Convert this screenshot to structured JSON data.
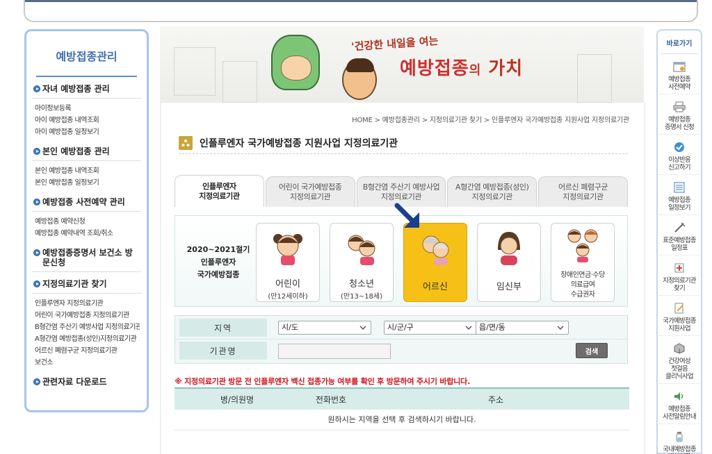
{
  "sidebar": {
    "title": "예방접종관리",
    "sections": [
      {
        "head": "자녀 예방접종 관리",
        "links": [
          "아이정보등록",
          "아이 예방접종 내역조회",
          "아이 예방접종 일정보기"
        ]
      },
      {
        "head": "본인 예방접종 관리",
        "links": [
          "본인 예방접종 내역조회",
          "본인 예방접종 일정보기"
        ]
      },
      {
        "head": "예방접종 사전예약 관리",
        "links": [
          "예방접종 예약신청",
          "예방접종 예약내역 조회/취소"
        ]
      },
      {
        "head": "예방접종증명서 보건소 방문신청",
        "links": []
      },
      {
        "head": "지정의료기관 찾기",
        "links": [
          "인플루엔자 지정의료기관",
          "어린이 국가예방접종 지정의료기관",
          "B형간염 주산기 예방사업 지정의료기관",
          "A형간염 예방접종(성인)지정의료기관",
          "어르신 폐렴구균 지정의료기관",
          "보건소"
        ]
      },
      {
        "head": "관련자료 다운로드",
        "links": []
      }
    ]
  },
  "banner": {
    "slogan": "'건강한 내일을 여는",
    "main_a": "예방접종",
    "main_b": "의",
    "main_c": "가치"
  },
  "breadcrumb": "HOME > 예방접종관리 > 지정의료기관 찾기 > 인플루엔자 국가예방접종 지원사업 지정의료기관",
  "page_title": "인플루엔자 국가예방접종 지원사업 지정의료기관",
  "tabs": [
    {
      "l1": "인플루엔자",
      "l2": "지정의료기관"
    },
    {
      "l1": "어린이 국가예방접종",
      "l2": "지정의료기관"
    },
    {
      "l1": "B형간염 주산기 예방사업",
      "l2": "지정의료기관"
    },
    {
      "l1": "A형간염 예방접종(성인)",
      "l2": "지정의료기관"
    },
    {
      "l1": "어르신 폐렴구균",
      "l2": "지정의료기관"
    }
  ],
  "category_label": {
    "l1": "2020~2021절기",
    "l2": "인플루엔자",
    "l3": "국가예방접종"
  },
  "categories": [
    {
      "name": "어린이",
      "sub": "(만12세이하)"
    },
    {
      "name": "청소년",
      "sub": "(만13~18세)"
    },
    {
      "name": "어르신",
      "sub": ""
    },
    {
      "name": "임신부",
      "sub": ""
    },
    {
      "l1": "장애인연금·수당",
      "l2": "의료급여",
      "l3": "수급권자"
    }
  ],
  "search": {
    "region_label": "지역",
    "sido": "시/도",
    "sigungu": "시/군/구",
    "eupmyeondong": "읍/면/동",
    "org_label": "기관명",
    "org_value": "",
    "search_button": "검색"
  },
  "notice": "※ 지정의료기관 방문 전 인플루엔자 백신 접종가능 여부를 확인 후 방문하여 주시기 바랍니다.",
  "table": {
    "headers": [
      "병/의원명",
      "전화번호",
      "주소"
    ],
    "empty": "원하시는 지역을 선택 후 검색하시기 바랍니다."
  },
  "quick": {
    "title": "바로가기",
    "items": [
      "예방접종\n사전예약",
      "예방접종\n증명서 신청",
      "이상반응\n신고하기",
      "예방접종\n일정보기",
      "표준예방접종\n일정표",
      "지정의료기관\n찾기",
      "국가예방접종\n지원사업",
      "건강여성\n첫걸음\n클리닉사업",
      "예방접종\n사전알림안내",
      "국내예방접종\n백신현황"
    ]
  },
  "colors": {
    "accent": "#3f6fb2",
    "selected": "#f6c016",
    "notice": "#d0121b",
    "table_head": "#d8ecea"
  }
}
